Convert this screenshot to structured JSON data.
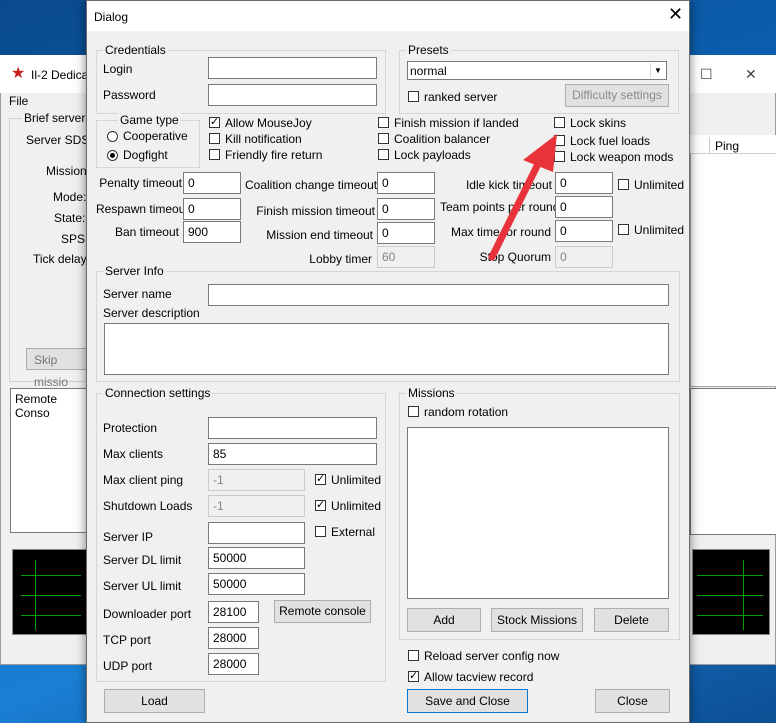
{
  "background_window": {
    "title": "Il-2 Dedica",
    "menu_file": "File",
    "group_label": "Brief server i",
    "labels": [
      "Server SDS:",
      "Mission:",
      "Mode:",
      "State:",
      "SPS:",
      "Tick delay:"
    ],
    "skip_button": "Skip missio",
    "remote_console_label": "Remote Conso",
    "table_header_ping": "Ping"
  },
  "dialog": {
    "title": "Dialog",
    "close_glyph": "✕"
  },
  "credentials": {
    "group_label": "Credentials",
    "login_label": "Login",
    "login_value": "",
    "password_label": "Password",
    "password_value": ""
  },
  "presets": {
    "group_label": "Presets",
    "selected": "normal",
    "ranked_label": "ranked server",
    "ranked_checked": false,
    "difficulty_button": "Difficulty settings"
  },
  "game_type": {
    "group_label": "Game type",
    "options": [
      {
        "label": "Cooperative",
        "selected": false
      },
      {
        "label": "Dogfight",
        "selected": true
      }
    ]
  },
  "options": {
    "allow_mousejoy": {
      "label": "Allow MouseJoy",
      "checked": true
    },
    "kill_notification": {
      "label": "Kill notification",
      "checked": false
    },
    "friendly_fire_return": {
      "label": "Friendly fire return",
      "checked": false
    },
    "finish_mission_if_landed": {
      "label": "Finish mission if landed",
      "checked": false
    },
    "coalition_balancer": {
      "label": "Coalition balancer",
      "checked": false
    },
    "lock_payloads": {
      "label": "Lock payloads",
      "checked": false
    },
    "lock_skins": {
      "label": "Lock skins",
      "checked": false
    },
    "lock_fuel_loads": {
      "label": "Lock fuel loads",
      "checked": false
    },
    "lock_weapon_mods": {
      "label": "Lock weapon mods",
      "checked": false
    }
  },
  "timeouts": {
    "penalty_timeout_label": "Penalty timeout",
    "penalty_timeout": "0",
    "respawn_timeout_label": "Respawn timeout",
    "respawn_timeout": "0",
    "ban_timeout_label": "Ban timeout",
    "ban_timeout": "900",
    "coalition_change_timeout_label": "Coalition change timeout",
    "coalition_change_timeout": "0",
    "finish_mission_timeout_label": "Finish mission timeout",
    "finish_mission_timeout": "0",
    "mission_end_timeout_label": "Mission end timeout",
    "mission_end_timeout": "0",
    "lobby_timer_label": "Lobby timer",
    "lobby_timer": "60",
    "idle_kick_timeout_label": "Idle kick timeout",
    "idle_kick_timeout": "0",
    "idle_kick_unlimited_label": "Unlimited",
    "idle_kick_unlimited": false,
    "team_points_per_round_label": "Team points per round",
    "team_points_per_round": "0",
    "max_time_per_round_label": "Max time for round",
    "max_time_per_round": "0",
    "max_time_unlimited_label": "Unlimited",
    "max_time_unlimited": false,
    "stop_quorum_label": "Stop Quorum",
    "stop_quorum": "0"
  },
  "server_info": {
    "group_label": "Server Info",
    "name_label": "Server name",
    "name_value": "",
    "description_label": "Server description",
    "description_value": ""
  },
  "connection": {
    "group_label": "Connection settings",
    "protection_label": "Protection",
    "protection": "",
    "max_clients_label": "Max clients",
    "max_clients": "85",
    "max_client_ping_label": "Max client ping",
    "max_client_ping": "-1",
    "ping_unlimited_label": "Unlimited",
    "ping_unlimited": true,
    "shutdown_loads_label": "Shutdown Loads",
    "shutdown_loads": "-1",
    "shutdown_unlimited_label": "Unlimited",
    "shutdown_unlimited": true,
    "server_ip_label": "Server IP",
    "server_ip": "",
    "external_label": "External",
    "external": false,
    "dl_limit_label": "Server DL limit",
    "dl_limit": "50000",
    "ul_limit_label": "Server UL limit",
    "ul_limit": "50000",
    "downloader_port_label": "Downloader port",
    "downloader_port": "28100",
    "remote_console_button": "Remote console",
    "tcp_port_label": "TCP port",
    "tcp_port": "28000",
    "udp_port_label": "UDP port",
    "udp_port": "28000"
  },
  "missions": {
    "group_label": "Missions",
    "random_rotation_label": "random rotation",
    "random_rotation": false,
    "add_button": "Add",
    "stock_button": "Stock Missions",
    "delete_button": "Delete"
  },
  "footer": {
    "reload_label": "Reload server config now",
    "reload_checked": false,
    "tacview_label": "Allow tacview record",
    "tacview_checked": true,
    "load_button": "Load",
    "save_close_button": "Save and Close",
    "close_button": "Close"
  },
  "colors": {
    "annotation_arrow": "#e8333b",
    "focus_border": "#0078d7"
  }
}
